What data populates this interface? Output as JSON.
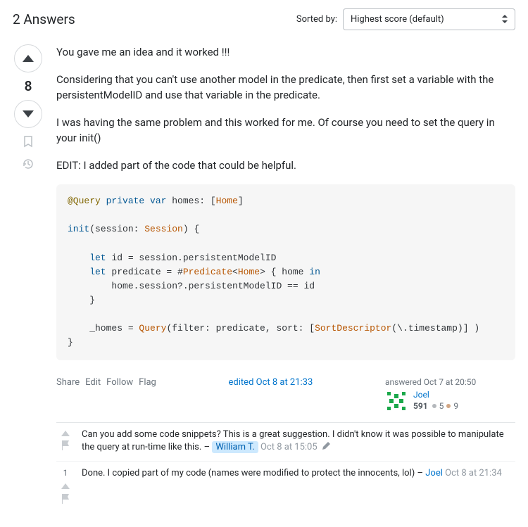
{
  "header": {
    "title": "2 Answers",
    "sort_label": "Sorted by:",
    "sort_value": "Highest score (default)"
  },
  "answer": {
    "score": "8",
    "paragraphs": {
      "p1": "You gave me an idea and it worked !!!",
      "p2": "Considering that you can't use another model in the predicate, then first set a variable with the persistentModelID and use that variable in the predicate.",
      "p3": "I was having the same problem and this worked for me. Of course you need to set the query in your init()",
      "p4": "EDIT: I added part of the code that could be helpful."
    },
    "code": {
      "l1a": "@Query",
      "l1b": " private",
      "l1c": " var",
      "l1d": " homes: [",
      "l1e": "Home",
      "l1f": "]",
      "l2a": "init",
      "l2b": "(session: ",
      "l2c": "Session",
      "l2d": ") {",
      "l3a": "    let",
      "l3b": " id = session.persistentModelID",
      "l4a": "    let",
      "l4b": " predicate = #",
      "l4c": "Predicate",
      "l4d": "<",
      "l4e": "Home",
      "l4f": "> { home ",
      "l4g": "in",
      "l5": "        home.session?.persistentModelID == id",
      "l6": "    }",
      "l7a": "    _homes = ",
      "l7b": "Query",
      "l7c": "(filter: predicate, sort: [",
      "l7d": "SortDescriptor",
      "l7e": "(\\.timestamp)] )",
      "l8": "}"
    },
    "menu": {
      "share": "Share",
      "edit": "Edit",
      "follow": "Follow",
      "flag": "Flag"
    },
    "edited": "edited Oct 8 at 21:33",
    "owner": {
      "when": "answered Oct 7 at 20:50",
      "name": "Joel",
      "rep": "591",
      "silver": "5",
      "bronze": "9"
    }
  },
  "comments": [
    {
      "score": "",
      "text": "Can you add some code snippets? This is a great suggestion. I didn't know it was possible to manipulate the query at run-time like this.",
      "user": "William T.",
      "owner": true,
      "time": "Oct 8 at 15:05",
      "edited": true
    },
    {
      "score": "1",
      "text": "Done. I copied part of my code (names were modified to protect the innocents, lol)",
      "user": "Joel",
      "owner": false,
      "time": "Oct 8 at 21:34",
      "edited": false
    }
  ]
}
